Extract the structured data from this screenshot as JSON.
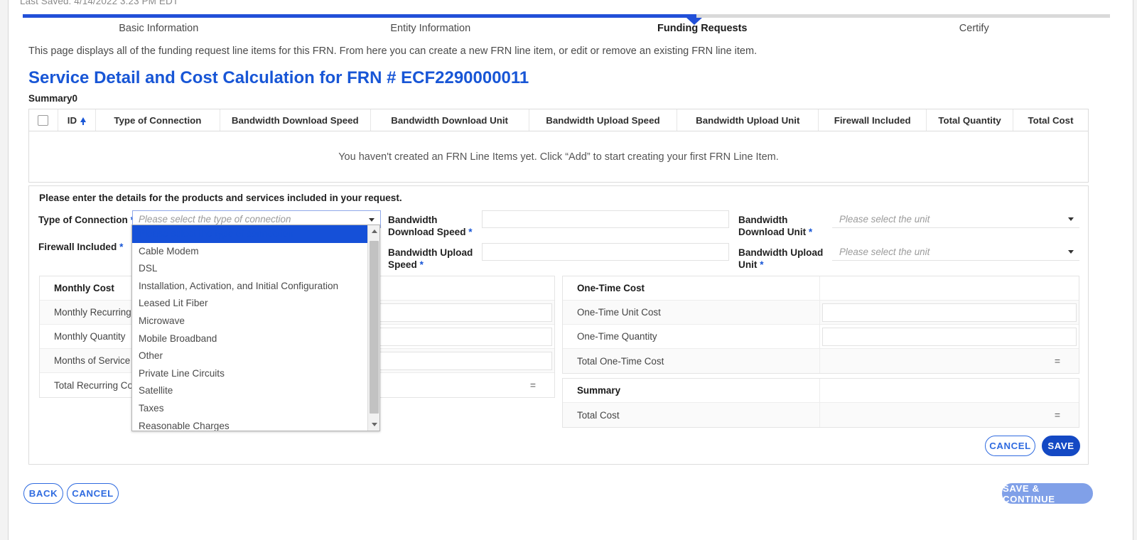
{
  "meta": {
    "last_saved": "Last Saved: 4/14/2022 3:23 PM EDT"
  },
  "stepper": {
    "steps": [
      {
        "label": "Basic Information",
        "state": "done"
      },
      {
        "label": "Entity Information",
        "state": "done"
      },
      {
        "label": "Funding Requests",
        "state": "current"
      },
      {
        "label": "Certify",
        "state": "upcoming"
      }
    ]
  },
  "intro_text": "This page displays all of the funding request line items for this FRN. From here you can create a new FRN line item, or edit or remove an existing FRN line item.",
  "page_title": "Service Detail and Cost Calculation for FRN # ECF2290000011",
  "summary": {
    "label": "Summary0",
    "columns": [
      "ID",
      "Type of Connection",
      "Bandwidth Download Speed",
      "Bandwidth Download Unit",
      "Bandwidth Upload Speed",
      "Bandwidth Upload Unit",
      "Firewall Included",
      "Total Quantity",
      "Total Cost"
    ],
    "empty_message": "You haven't created an FRN Line Items yet. Click “Add” to start creating your first FRN Line Item.",
    "sort_column": "ID",
    "sort_direction": "ascending"
  },
  "detail_panel": {
    "title": "Please enter the details for the products and services included in your request.",
    "fields": {
      "type_of_connection": {
        "label": "Type of Connection",
        "required": true,
        "placeholder": "Please select the type of connection",
        "value": ""
      },
      "firewall_included": {
        "label": "Firewall Included",
        "required": true
      },
      "bandwidth_download_speed": {
        "label": "Bandwidth Download Speed",
        "required": true,
        "value": ""
      },
      "bandwidth_upload_speed": {
        "label": "Bandwidth Upload Speed",
        "required": true,
        "value": ""
      },
      "bandwidth_download_unit": {
        "label": "Bandwidth Download Unit",
        "required": true,
        "placeholder": "Please select the unit",
        "value": ""
      },
      "bandwidth_upload_unit": {
        "label": "Bandwidth Upload Unit",
        "required": true,
        "placeholder": "Please select the unit",
        "value": ""
      }
    },
    "connection_options": [
      "Please select the type of connection",
      "Cable Modem",
      "DSL",
      "Installation, Activation, and Initial Configuration",
      "Leased Lit Fiber",
      "Microwave",
      "Mobile Broadband",
      "Other",
      "Private Line Circuits",
      "Satellite",
      "Taxes",
      "Reasonable Charges"
    ],
    "monthly_cost_table": {
      "header": "Monthly Cost",
      "rows": [
        {
          "label": "Monthly Recurring Unit Cost",
          "type": "input",
          "value": ""
        },
        {
          "label": "Monthly Quantity",
          "type": "input",
          "value": ""
        },
        {
          "label": "Months of Service",
          "type": "input",
          "value": ""
        },
        {
          "label": "Total Recurring Cost",
          "type": "computed",
          "value": "="
        }
      ]
    },
    "one_time_cost_table": {
      "header": "One-Time Cost",
      "rows": [
        {
          "label": "One-Time Unit Cost",
          "type": "input",
          "value": ""
        },
        {
          "label": "One-Time Quantity",
          "type": "input",
          "value": ""
        },
        {
          "label": "Total One-Time Cost",
          "type": "computed",
          "value": "="
        }
      ]
    },
    "summary_table": {
      "header": "Summary",
      "rows": [
        {
          "label": "Total Cost",
          "type": "computed",
          "value": "="
        }
      ]
    },
    "buttons": {
      "cancel": "CANCEL",
      "save": "SAVE"
    }
  },
  "footer": {
    "back": "BACK",
    "cancel": "CANCEL",
    "save_continue": "SAVE & CONTINUE"
  },
  "colors": {
    "accent": "#1856d6",
    "progress_fill": "#2250d8",
    "primary_button": "#1449c4",
    "disabled_button": "#80a0e8",
    "dropdown_selected": "#1550d8"
  }
}
